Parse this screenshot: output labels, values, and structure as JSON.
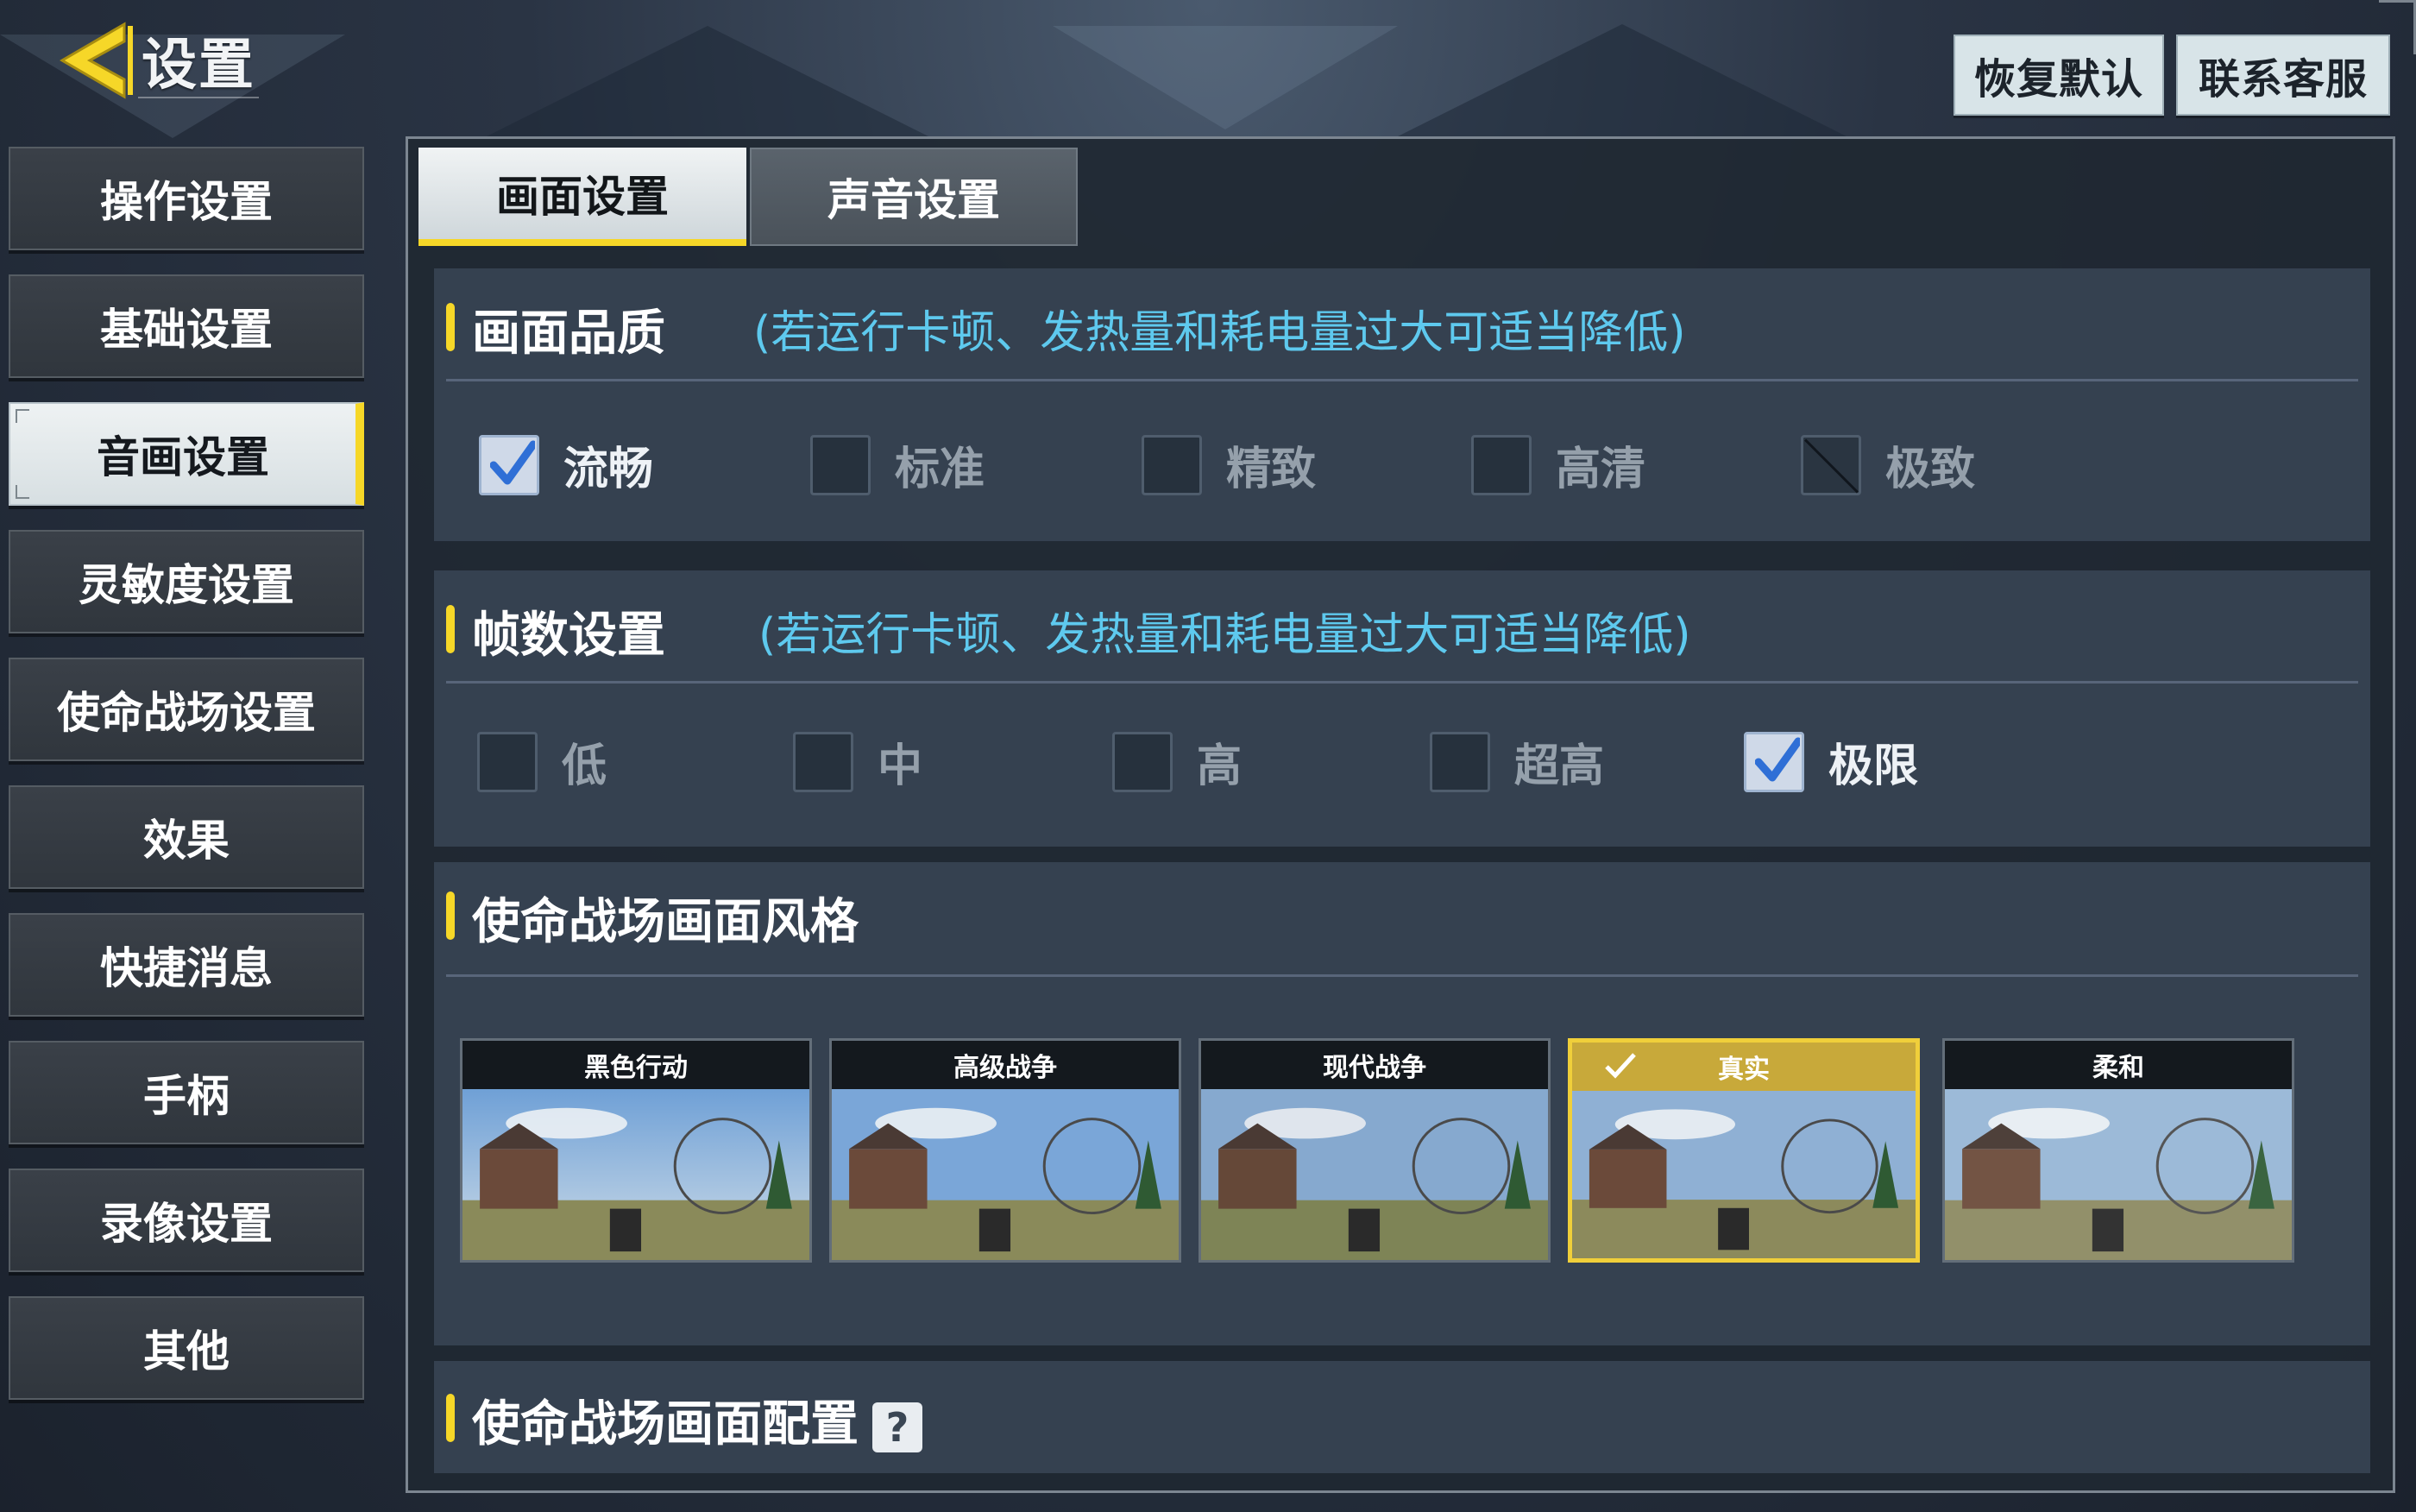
{
  "header": {
    "title": "设置",
    "restore_default": "恢复默认",
    "contact_support": "联系客服"
  },
  "sidebar": {
    "items": [
      {
        "label": "操作设置"
      },
      {
        "label": "基础设置"
      },
      {
        "label": "音画设置",
        "active": true
      },
      {
        "label": "灵敏度设置"
      },
      {
        "label": "使命战场设置"
      },
      {
        "label": "效果"
      },
      {
        "label": "快捷消息"
      },
      {
        "label": "手柄"
      },
      {
        "label": "录像设置"
      },
      {
        "label": "其他"
      }
    ]
  },
  "tabs": {
    "display": "画面设置",
    "sound": "声音设置"
  },
  "quality": {
    "title": "画面品质",
    "note": "(若运行卡顿、发热量和耗电量过大可适当降低)",
    "options": [
      "流畅",
      "标准",
      "精致",
      "高清",
      "极致"
    ],
    "selected": "流畅",
    "disabled": "极致"
  },
  "framerate": {
    "title": "帧数设置",
    "note": "(若运行卡顿、发热量和耗电量过大可适当降低)",
    "options": [
      "低",
      "中",
      "高",
      "超高",
      "极限"
    ],
    "selected": "极限"
  },
  "style": {
    "title": "使命战场画面风格",
    "cards": [
      "黑色行动",
      "高级战争",
      "现代战争",
      "真实",
      "柔和"
    ],
    "selected": "真实"
  },
  "config": {
    "title": "使命战场画面配置",
    "help_icon": "?"
  },
  "colors": {
    "accent": "#f6d728",
    "note": "#5ec9ee",
    "selected_card": "#f0cf3a"
  }
}
